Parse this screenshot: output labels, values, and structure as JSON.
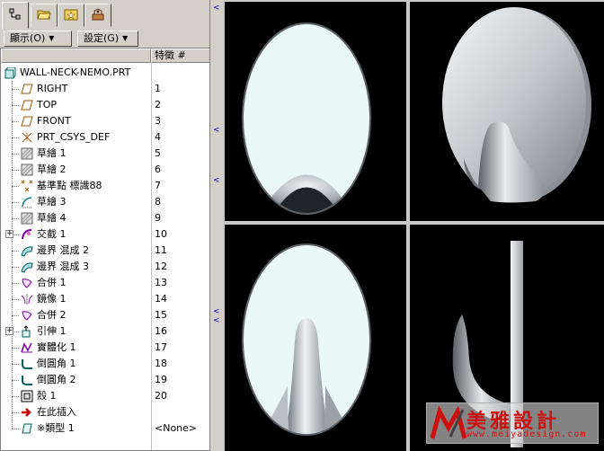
{
  "tabs": [
    {
      "icon": "model-tree-icon",
      "active": true
    },
    {
      "icon": "folder-browser-icon",
      "active": false
    },
    {
      "icon": "favorites-icon",
      "active": false
    },
    {
      "icon": "connections-icon",
      "active": false
    }
  ],
  "toolbar": {
    "display_label": "顯示(O)",
    "settings_label": "設定(G)"
  },
  "tree": {
    "column_feature_header": "特徵 #",
    "root_label": "WALL-NECK-NEMO.PRT",
    "items": [
      {
        "label": "RIGHT",
        "num": "1",
        "icon": "datum-plane-icon"
      },
      {
        "label": "TOP",
        "num": "2",
        "icon": "datum-plane-icon"
      },
      {
        "label": "FRONT",
        "num": "3",
        "icon": "datum-plane-icon"
      },
      {
        "label": "PRT_CSYS_DEF",
        "num": "4",
        "icon": "coordinate-system-icon"
      },
      {
        "label": "草繪 1",
        "num": "5",
        "icon": "sketch-icon"
      },
      {
        "label": "草繪 2",
        "num": "6",
        "icon": "sketch-icon"
      },
      {
        "label": "基準點 標識88",
        "num": "7",
        "icon": "datum-point-icon"
      },
      {
        "label": "草繪 3",
        "num": "8",
        "icon": "sketch-curve-icon"
      },
      {
        "label": "草繪 4",
        "num": "9",
        "icon": "sketch-icon"
      },
      {
        "label": "交截 1",
        "num": "10",
        "icon": "intersect-icon",
        "expandable": true
      },
      {
        "label": "邊界 混成 2",
        "num": "11",
        "icon": "boundary-blend-icon"
      },
      {
        "label": "邊界 混成 3",
        "num": "12",
        "icon": "boundary-blend-icon"
      },
      {
        "label": "合併 1",
        "num": "13",
        "icon": "merge-icon"
      },
      {
        "label": "鏡像 1",
        "num": "14",
        "icon": "mirror-icon"
      },
      {
        "label": "合併 2",
        "num": "15",
        "icon": "merge-icon"
      },
      {
        "label": "引伸 1",
        "num": "16",
        "icon": "extrude-icon",
        "expandable": true
      },
      {
        "label": "實體化 1",
        "num": "17",
        "icon": "solidify-icon"
      },
      {
        "label": "倒圓角 1",
        "num": "18",
        "icon": "round-icon"
      },
      {
        "label": "倒圓角 2",
        "num": "19",
        "icon": "round-icon"
      },
      {
        "label": "殼 1",
        "num": "20",
        "icon": "shell-icon"
      },
      {
        "label": "在此插入",
        "num": "",
        "icon": "insert-here-arrow-icon"
      },
      {
        "label": "※類型 1",
        "num": "<None>",
        "icon": "pattern-icon"
      }
    ]
  },
  "watermark": {
    "brand_cn": "美雅設計",
    "url": "www.meiyadesign.com"
  },
  "colors": {
    "panel_bg": "#d4d0c8",
    "viewport_bg": "#000000",
    "model_face": "#eaf8f8",
    "model_metal": "#c8ccd0",
    "watermark_red": "#cc1010"
  }
}
